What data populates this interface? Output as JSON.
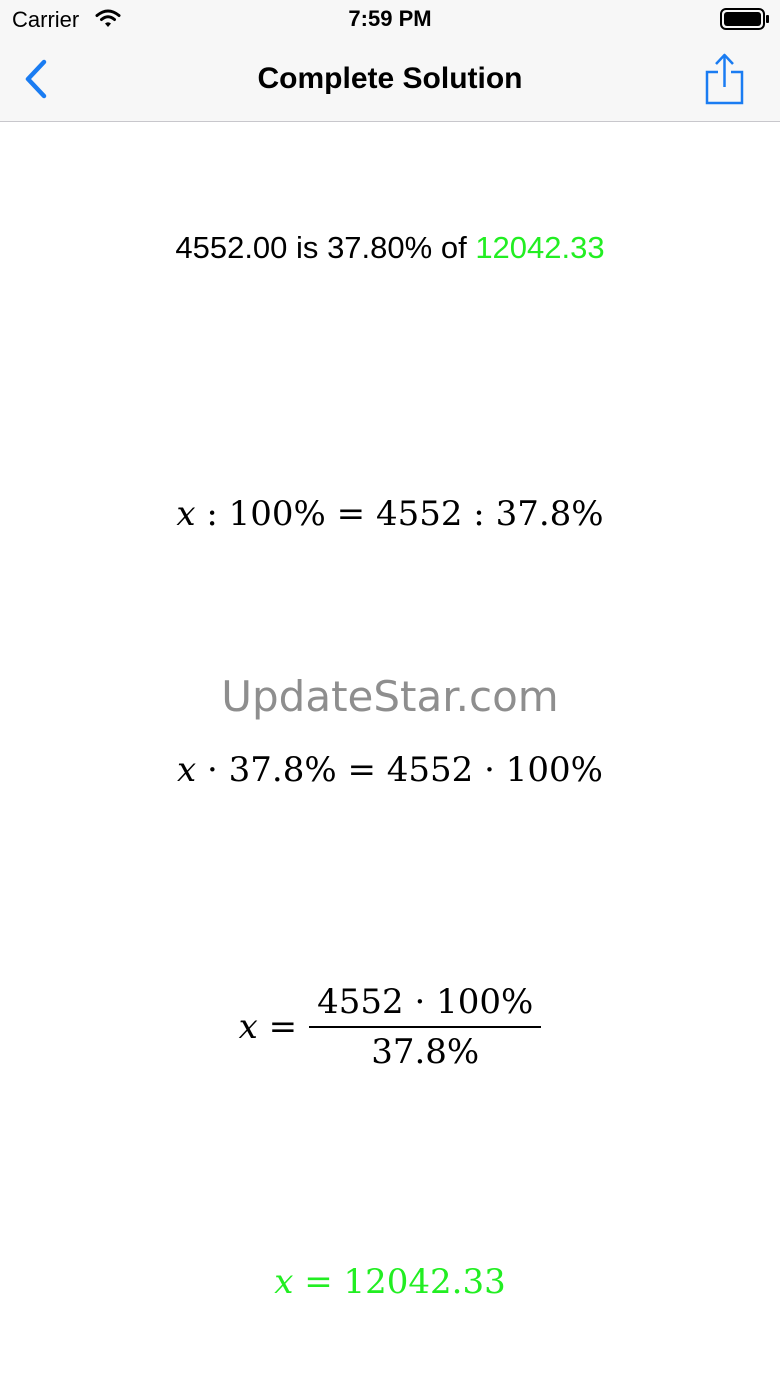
{
  "status_bar": {
    "carrier": "Carrier",
    "time": "7:59 PM",
    "wifi_icon": "wifi-icon",
    "battery_icon": "battery-icon"
  },
  "nav": {
    "title": "Complete Solution",
    "back_icon": "chevron-left-icon",
    "share_icon": "share-icon",
    "accent_color": "#1a7cf2"
  },
  "summary": {
    "part": "4552.00",
    "connector_is": "is",
    "percent": "37.80%",
    "connector_of": "of",
    "result": "12042.33",
    "result_color": "#22ee22"
  },
  "steps": {
    "step1": {
      "var": "x",
      "rest": " : 100% = 4552 : 37.8%"
    },
    "step2": {
      "var": "x",
      "rest": " · 37.8% = 4552 · 100%"
    },
    "step3": {
      "var": "x",
      "eq": " =",
      "numerator": "4552 · 100%",
      "denominator": "37.8%"
    },
    "step4": {
      "var": "x",
      "rest": " = 12042.33"
    }
  },
  "watermark": "UpdateStar.com"
}
